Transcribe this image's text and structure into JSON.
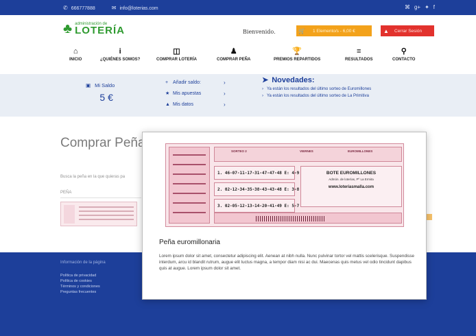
{
  "topbar": {
    "phone": "666777888",
    "email": "info@loterias.com",
    "social_icons": [
      "rss-icon",
      "google-plus-icon",
      "twitter-icon",
      "facebook-icon"
    ]
  },
  "logo": {
    "small": "administración de",
    "big": "LOTERÍA"
  },
  "header": {
    "welcome": "Bienvenido.",
    "cart_label": "1 Elemento/s - 6,00 €",
    "logout_label": "Cerrar Sesión"
  },
  "nav": [
    {
      "label": "INICIO",
      "icon": "home-icon"
    },
    {
      "label": "¿QUIÉNES SOMOS?",
      "icon": "info-icon"
    },
    {
      "label": "COMPRAR LOTERÍA",
      "icon": "ticket-icon"
    },
    {
      "label": "COMPRAR PEÑA",
      "icon": "group-icon"
    },
    {
      "label": "PREMIOS REPARTIDOS",
      "icon": "trophy-icon"
    },
    {
      "label": "RESULTADOS",
      "icon": "list-icon"
    },
    {
      "label": "CONTACTO",
      "icon": "map-marker-icon"
    }
  ],
  "account": {
    "saldo_label": "Mi Saldo",
    "saldo_value": "5 €",
    "links": [
      {
        "label": "Añadir saldo:",
        "icon": "plus-icon"
      },
      {
        "label": "Mis apuestas",
        "icon": "trophy-icon"
      },
      {
        "label": "Mis datos",
        "icon": "user-icon"
      }
    ]
  },
  "news": {
    "title": "Novedades:",
    "items": [
      "Ya están los resultados del último sorteo de Euromillones",
      "Ya están los resultados del último sorteo de La Primitiva"
    ]
  },
  "page": {
    "title": "Comprar Peña",
    "search_hint": "Busca la peña en la que quieras pa",
    "column_header": "PEÑA"
  },
  "footer": {
    "heading": "Información de la página",
    "links": [
      "Política de privacidad",
      "Política de cookies",
      "Términos y condiciones",
      "Preguntas frecuentes"
    ]
  },
  "modal": {
    "title": "Peña euromillonaria",
    "body": "Lorem ipsum dolor sit amet, consectetur adipiscing elit. Aenean at nibh nulla. Nunc pulvinar tortor vel mattis scelerisque. Suspendisse interdum, arcu id blandit rutrum, augue elit luctus magna, a tempor diam nisi ac dui. Maecenas quis metus vel odio tincidunt dapibus quis at augue. Lorem ipsum dolor sit amet.",
    "ticket": {
      "header_left": "SORTEO 2",
      "header_mid": "VIERNES",
      "header_right": "EUROMILLONES",
      "lines": [
        "1. 46-07-11-17-31-47-47-48 E: 4-9",
        "2. 02-12-34-35-38-43-43-48 E: 3-8",
        "3. 02-05-12-13-14-20-41-49 E: 5-7"
      ],
      "right_title": "BOTE EUROMILLONES",
      "right_addr": "Admón. de loterías, Pº La Ermita",
      "right_web": "www.loteriasmalla.com"
    }
  }
}
